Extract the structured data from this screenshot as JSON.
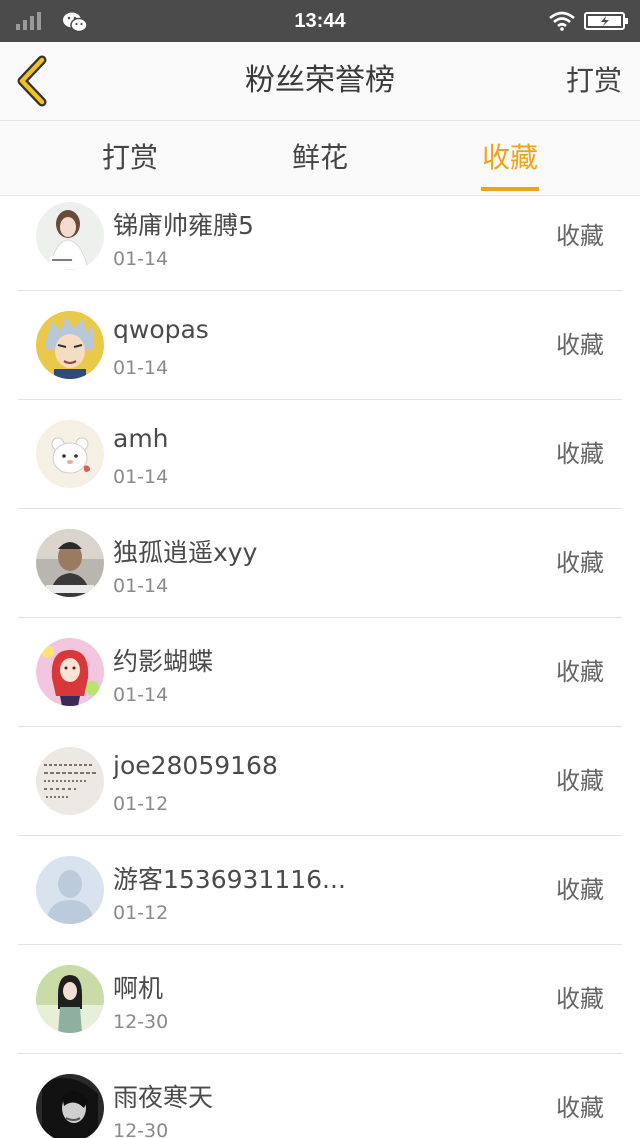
{
  "status_bar": {
    "time": "13:44"
  },
  "header": {
    "title": "粉丝荣誉榜",
    "action_label": "打赏"
  },
  "tabs": [
    {
      "label": "打赏",
      "active": false
    },
    {
      "label": "鲜花",
      "active": false
    },
    {
      "label": "收藏",
      "active": true
    }
  ],
  "colors": {
    "accent": "#f0a316",
    "status_bar_bg": "#4b4b4b"
  },
  "fans": [
    {
      "name": "锑庯帅雍膊5",
      "date": "01-14",
      "type": "收藏",
      "avatar": "girl-photo-avatar"
    },
    {
      "name": "qwopas",
      "date": "01-14",
      "type": "收藏",
      "avatar": "anime-boy-avatar"
    },
    {
      "name": "amh",
      "date": "01-14",
      "type": "收藏",
      "avatar": "cartoon-bear-avatar"
    },
    {
      "name": "独孤逍遥xyy",
      "date": "01-14",
      "type": "收藏",
      "avatar": "selfie-avatar"
    },
    {
      "name": "约影蝴蝶",
      "date": "01-14",
      "type": "收藏",
      "avatar": "anime-girl-avatar"
    },
    {
      "name": "joe28059168",
      "date": "01-12",
      "type": "收藏",
      "avatar": "handwriting-avatar"
    },
    {
      "name": "游客1536931116...",
      "date": "01-12",
      "type": "收藏",
      "avatar": "default-user-avatar"
    },
    {
      "name": "啊机",
      "date": "12-30",
      "type": "收藏",
      "avatar": "girl-nature-avatar"
    },
    {
      "name": "雨夜寒天",
      "date": "12-30",
      "type": "收藏",
      "avatar": "dark-portrait-avatar"
    }
  ]
}
